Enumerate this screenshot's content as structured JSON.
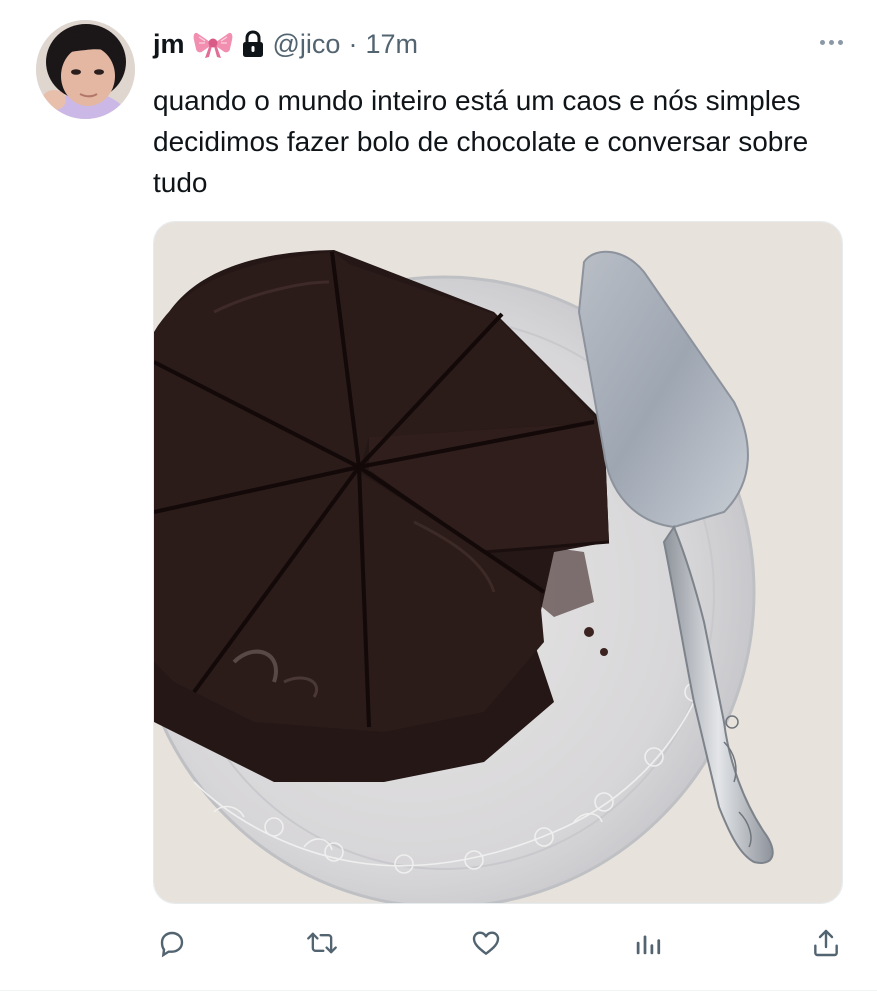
{
  "tweet": {
    "display_name": "jm",
    "handle": "@jico",
    "separator": "·",
    "time": "17m",
    "text": "quando o mundo inteiro está um caos e nós simples decidimos fazer bolo de chocolate e conversar sobre tudo",
    "badges": [
      "bow-icon",
      "lock-icon"
    ]
  },
  "media": {
    "description_icons": [
      "plate",
      "chocolate-cake",
      "cake-server"
    ]
  },
  "actions": {
    "reply_icon": "reply-icon",
    "retweet_icon": "retweet-icon",
    "like_icon": "like-icon",
    "views_icon": "views-icon",
    "share_icon": "share-icon"
  },
  "colors": {
    "text_primary": "#0f1419",
    "text_secondary": "#536471",
    "icon": "#536471",
    "bow": "#f28fb1",
    "background": "#ffffff"
  }
}
